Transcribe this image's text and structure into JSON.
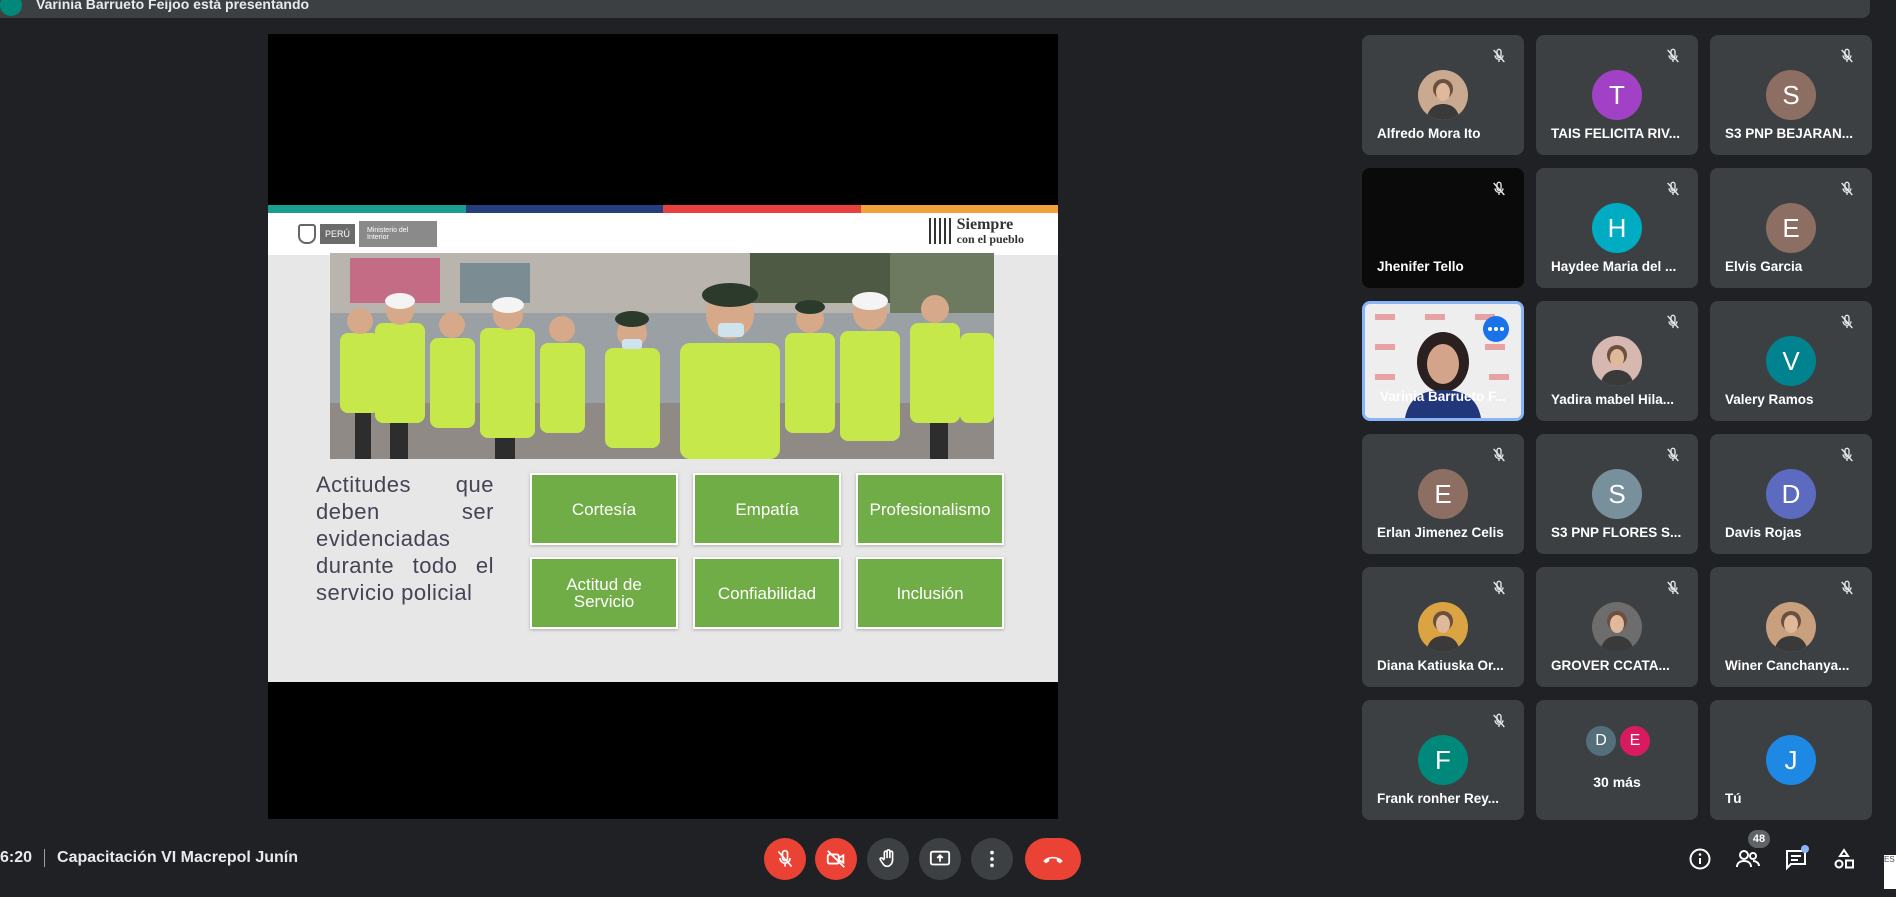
{
  "banner": {
    "text": "Varinia Barrueto Feijoo está presentando"
  },
  "slide": {
    "stripe_colors": [
      "#1a9e8f",
      "#253e7d",
      "#e8403e",
      "#f2a03a"
    ],
    "logo_peru": "PERÚ",
    "logo_ministry": "Ministerio del Interior",
    "logo_right_line1": "Siempre",
    "logo_right_line2": "con el pueblo",
    "left_text": "Actitudes que deben ser evidenciadas durante todo el servicio policial",
    "boxes": [
      "Cortesía",
      "Empatía",
      "Profesionalismo",
      "Actitud de Servicio",
      "Confiabilidad",
      "Inclusión"
    ],
    "box_color": "#70ad47"
  },
  "participants": [
    {
      "name": "Alfredo Mora Ito",
      "avatar": "photo",
      "color": "#c9a98f"
    },
    {
      "name": "TAIS FELICITA RIV...",
      "avatar": "T",
      "color": "#a142c6"
    },
    {
      "name": "S3 PNP BEJARAN...",
      "avatar": "S",
      "color": "#8d6e63"
    },
    {
      "name": "Jhenifer Tello",
      "avatar": "",
      "color": "#0a0a0a"
    },
    {
      "name": "Haydee Maria del ...",
      "avatar": "H",
      "color": "#00acc1"
    },
    {
      "name": "Elvis Garcia",
      "avatar": "E",
      "color": "#8d6e63"
    },
    {
      "name": "Varinia Barrueto F...",
      "avatar": "video",
      "color": "#e6e6e6"
    },
    {
      "name": "Yadira mabel Hila...",
      "avatar": "photo",
      "color": "#d7b8b0"
    },
    {
      "name": "Valery Ramos",
      "avatar": "V",
      "color": "#00838f"
    },
    {
      "name": "Erlan Jimenez Celis",
      "avatar": "E",
      "color": "#8d6e63"
    },
    {
      "name": "S3 PNP FLORES S...",
      "avatar": "S",
      "color": "#78909c"
    },
    {
      "name": "Davis Rojas",
      "avatar": "D",
      "color": "#5c6bc0"
    },
    {
      "name": "Diana Katiuska Or...",
      "avatar": "photo",
      "color": "#d9a441"
    },
    {
      "name": "GROVER CCATA...",
      "avatar": "photo",
      "color": "#6d6d6d"
    },
    {
      "name": "Winer Canchanya...",
      "avatar": "photo",
      "color": "#c8a07e"
    },
    {
      "name": "Frank ronher Rey...",
      "avatar": "F",
      "color": "#00897b"
    },
    {
      "name": "30 más",
      "avatar": "more",
      "more_avatars": [
        "D",
        "E"
      ],
      "more_colors": [
        "#546e7a",
        "#d81b60"
      ]
    },
    {
      "name": "Tú",
      "avatar": "J",
      "color": "#1e88e5"
    }
  ],
  "bottom": {
    "time": "6:20",
    "meeting_title": "Capacitación VI Macrepol Junín",
    "participant_count": "48",
    "corner_text": "ES"
  },
  "colors": {
    "red": "#ea4335",
    "grey": "#3c4043",
    "accent": "#8ab4f8"
  },
  "icons": {
    "mic": "mic-off-icon",
    "cam": "videocam-off-icon",
    "hand": "raise-hand-icon",
    "present": "present-screen-icon",
    "more": "more-vert-icon",
    "end": "call-end-icon",
    "info": "info-icon",
    "people": "people-icon",
    "chat": "chat-icon",
    "activities": "activities-icon"
  }
}
